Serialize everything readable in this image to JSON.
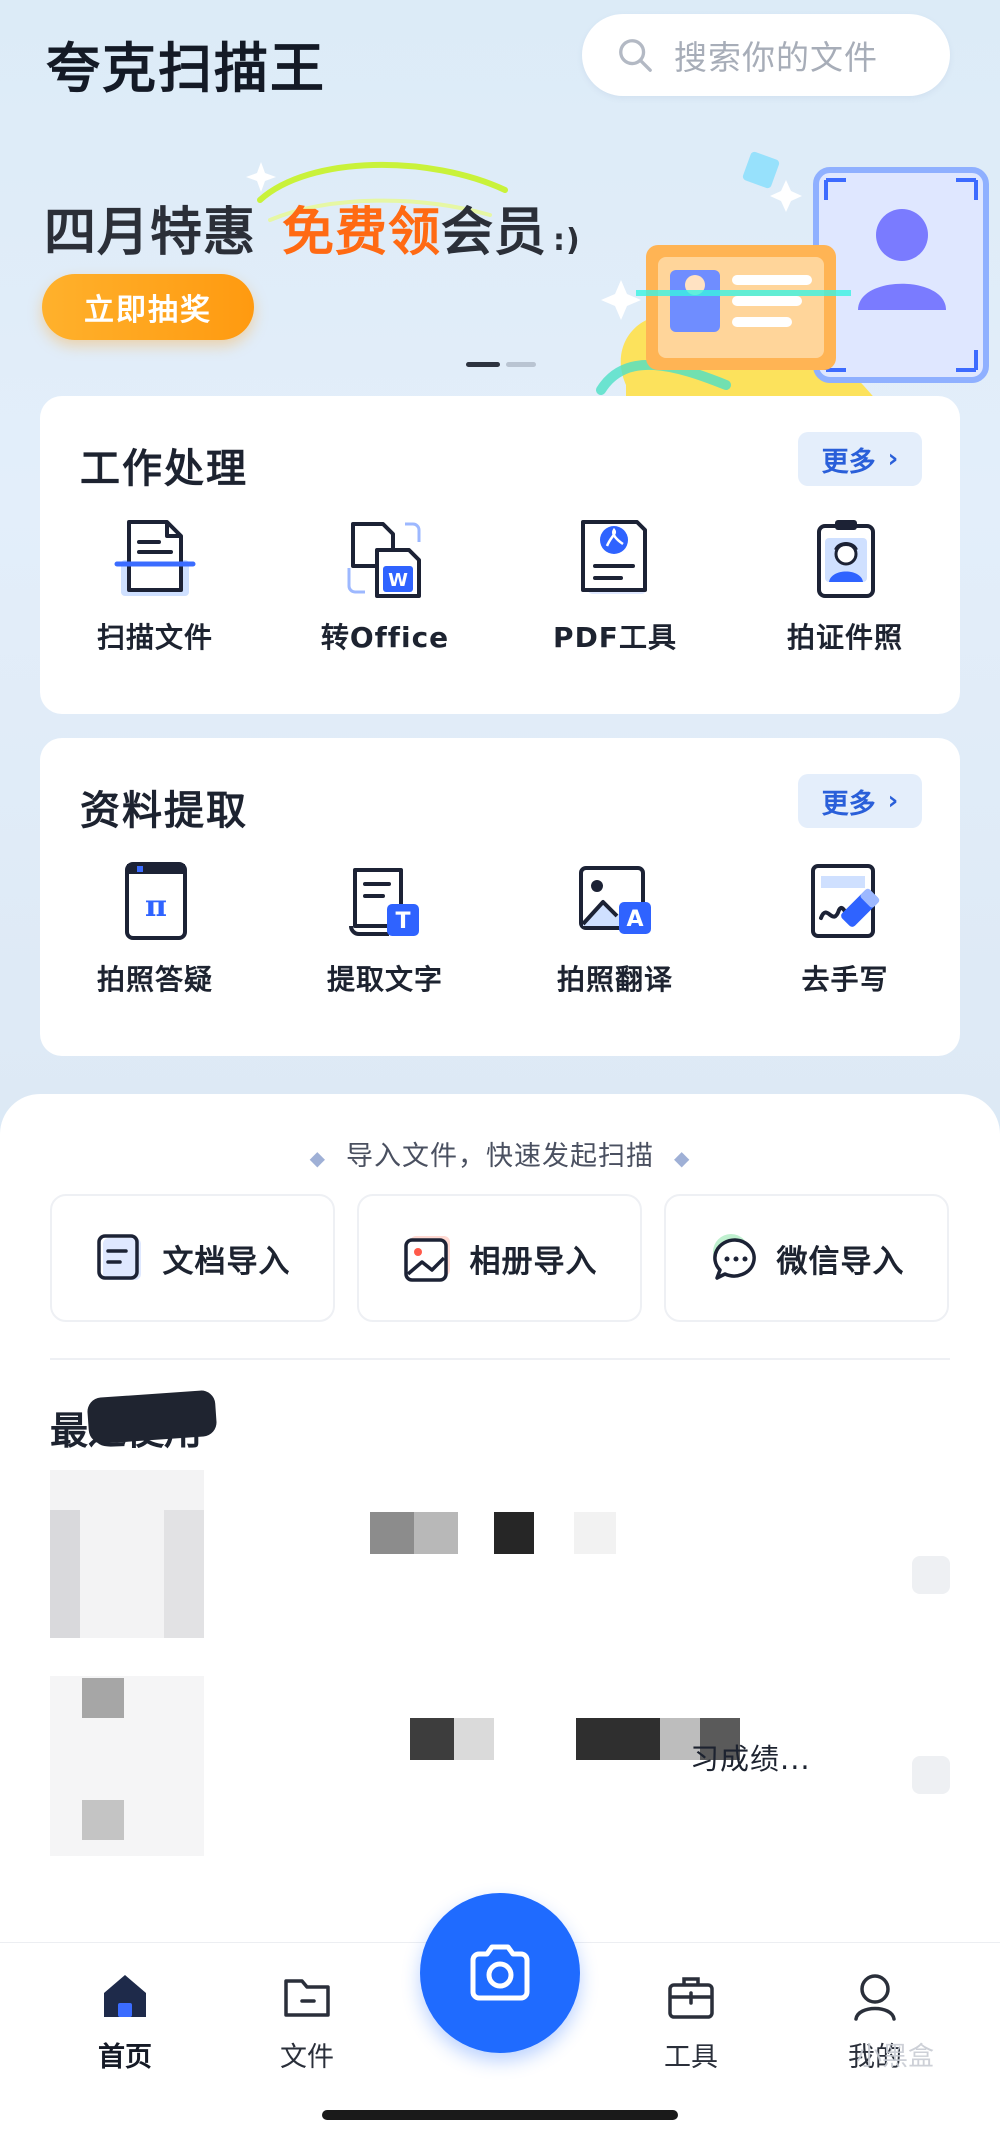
{
  "header": {
    "app_title": "夸克扫描王",
    "search_placeholder": "搜索你的文件"
  },
  "banner": {
    "headline_part1": "四月特惠",
    "headline_highlight": "免费领",
    "headline_part2": "会员",
    "headline_smile": ":)",
    "cta_label": "立即抽奖"
  },
  "work_section": {
    "title": "工作处理",
    "more_label": "更多",
    "items": [
      {
        "label": "扫描文件",
        "icon": "scan-document-icon"
      },
      {
        "label": "转Office",
        "icon": "word-convert-icon"
      },
      {
        "label": "PDF工具",
        "icon": "pdf-tool-icon"
      },
      {
        "label": "拍证件照",
        "icon": "id-photo-icon"
      }
    ]
  },
  "extract_section": {
    "title": "资料提取",
    "more_label": "更多",
    "items": [
      {
        "label": "拍照答疑",
        "icon": "pi-question-icon"
      },
      {
        "label": "提取文字",
        "icon": "extract-text-icon"
      },
      {
        "label": "拍照翻译",
        "icon": "photo-translate-icon"
      },
      {
        "label": "去手写",
        "icon": "remove-handwriting-icon"
      }
    ]
  },
  "import": {
    "hint": "导入文件，快速发起扫描",
    "buttons": [
      {
        "label": "文档导入",
        "icon": "document-import-icon"
      },
      {
        "label": "相册导入",
        "icon": "album-import-icon"
      },
      {
        "label": "微信导入",
        "icon": "wechat-import-icon"
      }
    ]
  },
  "recent": {
    "title": "最近使用",
    "files": [
      {
        "name_visible": ""
      },
      {
        "name_visible": "习成绩..."
      }
    ]
  },
  "tabbar": {
    "tabs": [
      {
        "label": "首页",
        "icon": "home-icon",
        "active": true
      },
      {
        "label": "文件",
        "icon": "folder-icon",
        "active": false
      },
      {
        "label": "工具",
        "icon": "toolbox-icon",
        "active": false
      },
      {
        "label": "我的",
        "icon": "profile-icon",
        "active": false
      }
    ],
    "camera_icon": "camera-icon"
  },
  "watermark": "小黑盒",
  "colors": {
    "accent": "#1f6bff",
    "orange": "#ff6a13",
    "more_text": "#2a5fd9",
    "background": "#dbe9f6"
  }
}
